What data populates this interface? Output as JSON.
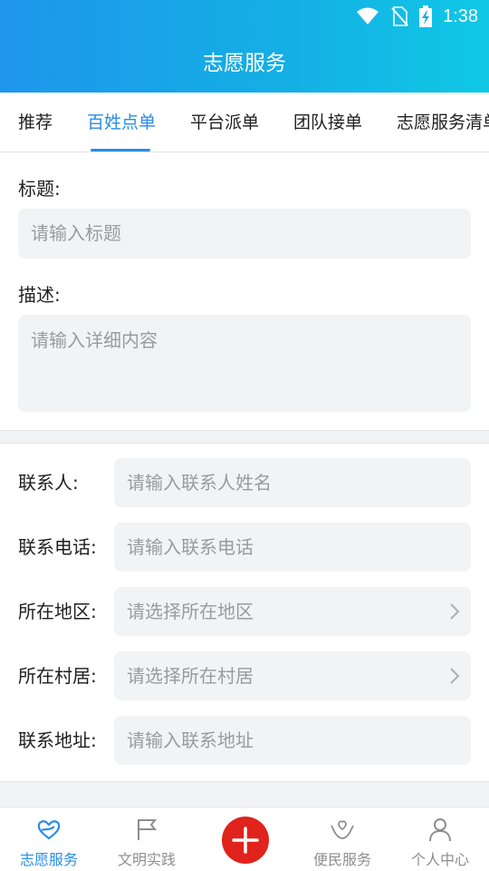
{
  "status_bar": {
    "time": "1:38"
  },
  "header": {
    "title": "志愿服务"
  },
  "tabs": [
    {
      "label": "推荐"
    },
    {
      "label": "百姓点单"
    },
    {
      "label": "平台派单"
    },
    {
      "label": "团队接单"
    },
    {
      "label": "志愿服务清单"
    }
  ],
  "form": {
    "title_label": "标题:",
    "title_placeholder": "请输入标题",
    "desc_label": "描述:",
    "desc_placeholder": "请输入详细内容"
  },
  "contact": {
    "name_label": "联系人:",
    "name_placeholder": "请输入联系人姓名",
    "phone_label": "联系电话:",
    "phone_placeholder": "请输入联系电话",
    "region_label": "所在地区:",
    "region_placeholder": "请选择所在地区",
    "village_label": "所在村居:",
    "village_placeholder": "请选择所在村居",
    "address_label": "联系地址:",
    "address_placeholder": "请输入联系地址"
  },
  "bottom_nav": {
    "items": [
      {
        "label": "志愿服务"
      },
      {
        "label": "文明实践"
      },
      {
        "label": "便民服务"
      },
      {
        "label": "个人中心"
      }
    ]
  },
  "colors": {
    "accent": "#2a8ce8",
    "header_gradient_start": "#1e96ec",
    "header_gradient_end": "#10c8e6",
    "add_button": "#e0231c",
    "input_bg": "#f2f3f5"
  }
}
